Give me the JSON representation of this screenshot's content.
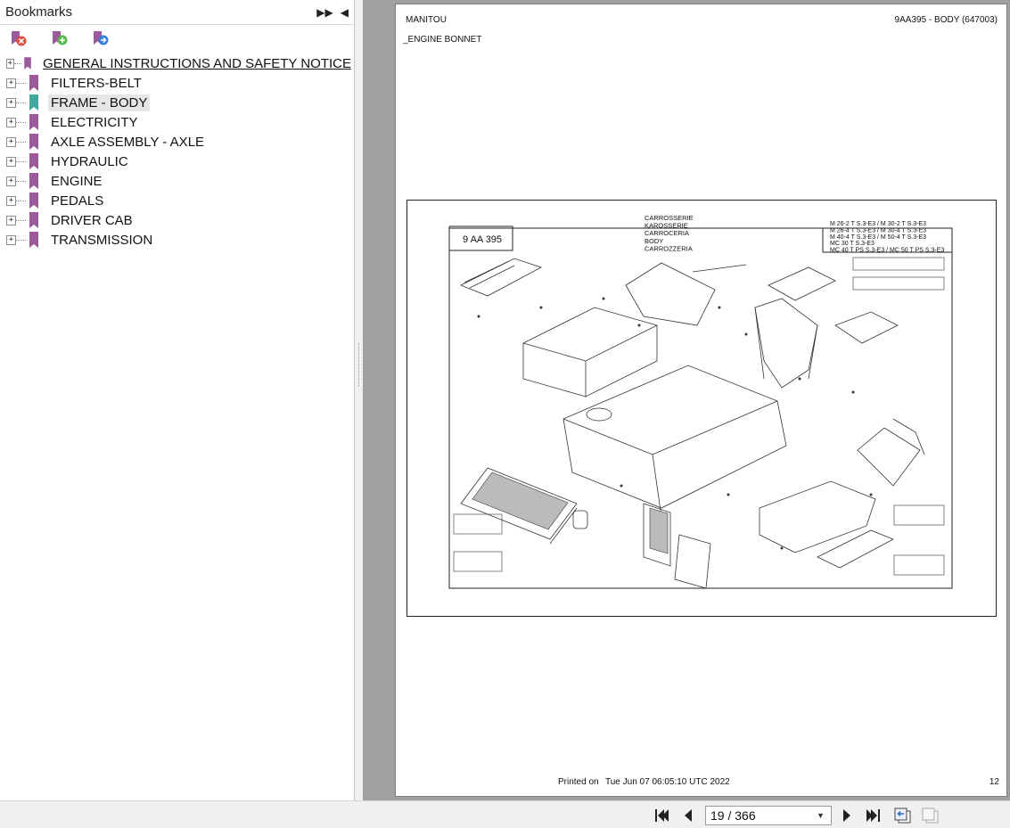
{
  "panel": {
    "title": "Bookmarks",
    "bookmarks": [
      {
        "label": "GENERAL INSTRUCTIONS AND SAFETY NOTICE"
      },
      {
        "label": "FILTERS-BELT"
      },
      {
        "label": "FRAME - BODY"
      },
      {
        "label": "ELECTRICITY"
      },
      {
        "label": "AXLE ASSEMBLY - AXLE"
      },
      {
        "label": "HYDRAULIC"
      },
      {
        "label": "ENGINE"
      },
      {
        "label": "PEDALS"
      },
      {
        "label": "DRIVER CAB"
      },
      {
        "label": "TRANSMISSION"
      }
    ],
    "expander_glyph": "+"
  },
  "page": {
    "brand": "MANITOU",
    "doc_code": "9AA395 - BODY (647003)",
    "section": "_ENGINE BONNET",
    "drawing": {
      "ref_box": "9 AA 395",
      "names": [
        "CARROSSERIE",
        "KAROSSERIE",
        "CARROCERIA",
        "BODY",
        "CARROZZERIA"
      ],
      "models": [
        "M 26-2 T S.3-E3 / M 30-2 T S.3-E3",
        "M 26-4 T S.3-E3 / M 30-4 T S.3-E3",
        "M 40-4 T S.3-E3 / M 50-4 T S.3-E3",
        "MC 30 T S.3-E3",
        "MC 40 T PS S.3-E3 / MC 50 T PS S.3-E3"
      ]
    },
    "printed_label": "Printed on",
    "printed_date": "Tue Jun 07 06:05:10 UTC 2022",
    "page_number": "12"
  },
  "nav": {
    "page_indicator": "19 / 366"
  },
  "colors": {
    "bookmark_purple": "#9b5a9b",
    "bookmark_teal": "#3fa9a0",
    "viewport_bg": "#a0a0a0"
  }
}
